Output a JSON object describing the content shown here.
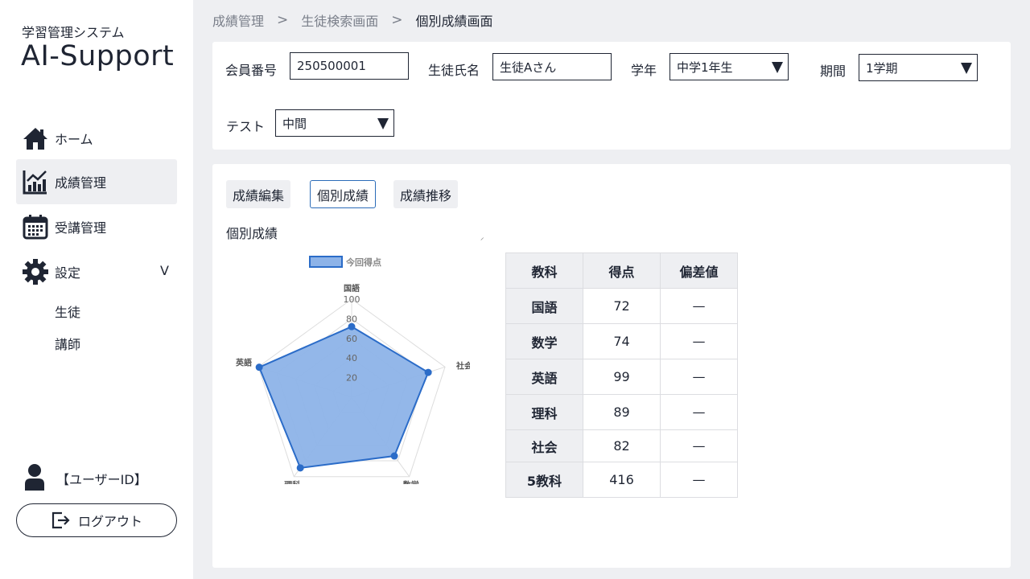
{
  "app": {
    "subtitle": "学習管理システム",
    "name": "AI-Support"
  },
  "nav": {
    "home": "ホーム",
    "grades": "成績管理",
    "attendance": "受講管理",
    "settings": "設定",
    "settings_chevron": "V",
    "sub_students": "生徒",
    "sub_teachers": "講師"
  },
  "user": {
    "label": "【ユーザーID】",
    "logout": "ログアウト"
  },
  "breadcrumb": {
    "c1": "成績管理",
    "c2": "生徒検索画面",
    "c3": "個別成績画面",
    "sep": ">"
  },
  "filter": {
    "member_label": "会員番号",
    "member_value": "250500001",
    "name_label": "生徒氏名",
    "name_value": "生徒Aさん",
    "grade_label": "学年",
    "grade_value": "中学1年生",
    "period_label": "期間",
    "period_value": "1学期",
    "test_label": "テスト",
    "test_value": "中間"
  },
  "tabs": {
    "edit": "成績編集",
    "individual": "個別成績",
    "trend": "成績推移"
  },
  "section_title": "個別成績",
  "stray_mark": "⸝",
  "chart_data": {
    "type": "radar",
    "legend": "今回得点",
    "axes": [
      "国語",
      "社会",
      "数学",
      "理科",
      "英語"
    ],
    "values": [
      72,
      82,
      74,
      89,
      99
    ],
    "ticks": [
      "20",
      "40",
      "60",
      "80",
      "100"
    ],
    "rmax": 100,
    "fill_color": "#8db3e8",
    "line_color": "#2b6cc8"
  },
  "table": {
    "headers": [
      "教科",
      "得点",
      "偏差値"
    ],
    "rows": [
      {
        "subject": "国語",
        "score": "72",
        "dev": "—"
      },
      {
        "subject": "数学",
        "score": "74",
        "dev": "—"
      },
      {
        "subject": "英語",
        "score": "99",
        "dev": "—"
      },
      {
        "subject": "理科",
        "score": "89",
        "dev": "—"
      },
      {
        "subject": "社会",
        "score": "82",
        "dev": "—"
      },
      {
        "subject": "5教科",
        "score": "416",
        "dev": "—"
      }
    ]
  }
}
